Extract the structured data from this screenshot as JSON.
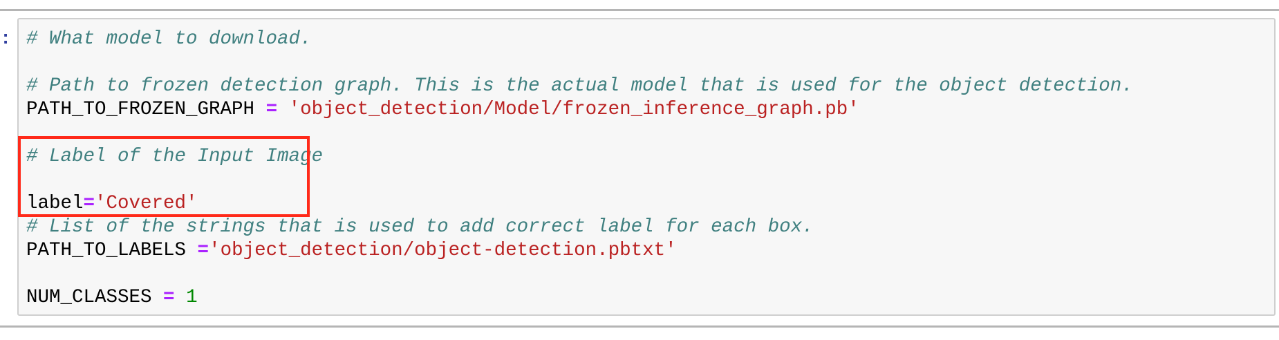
{
  "prompt": ":",
  "code": {
    "l1_comment": "# What model to download.",
    "l3_comment": "# Path to frozen detection graph. This is the actual model that is used for the object detection.",
    "l4_var": "PATH_TO_FROZEN_GRAPH ",
    "l4_op": "=",
    "l4_str": " 'object_detection/Model/frozen_inference_graph.pb'",
    "l6_comment": "# Label of the Input Image",
    "l8_var": "label",
    "l8_op": "=",
    "l8_str": "'Covered'",
    "l9_comment": "# List of the strings that is used to add correct label for each box.",
    "l10_var": "PATH_TO_LABELS ",
    "l10_op": "=",
    "l10_str": "'object_detection/object-detection.pbtxt'",
    "l12_var": "NUM_CLASSES ",
    "l12_op": "=",
    "l12_num": " 1"
  },
  "colors": {
    "comment": "#408080",
    "string": "#ba2121",
    "operator": "#aa22ff",
    "number": "#008800",
    "highlight": "#ff2a1a"
  }
}
